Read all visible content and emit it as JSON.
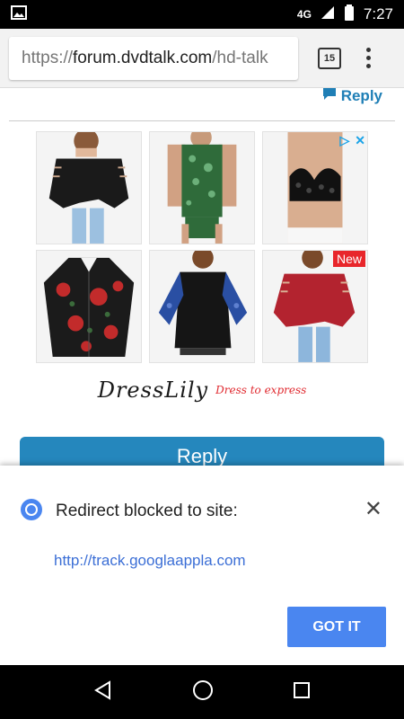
{
  "status_bar": {
    "network": "4G",
    "time": "7:27",
    "icons": [
      "image-notification-icon",
      "signal-icon",
      "battery-icon"
    ]
  },
  "browser": {
    "url_scheme": "https://",
    "url_domain": "forum.dvdtalk.com",
    "url_path": "/hd-talk",
    "tab_count": "15",
    "menu_icon": "overflow-menu-icon"
  },
  "page": {
    "reply_link": "Reply",
    "reply_button": "Reply"
  },
  "ad": {
    "choices_icons": [
      "ad-choices-icon",
      "ad-close-icon"
    ],
    "products": [
      {
        "name": "black-cutout-top"
      },
      {
        "name": "green-print-tank"
      },
      {
        "name": "black-lace-bralette"
      },
      {
        "name": "floral-shirt"
      },
      {
        "name": "black-blue-sleeve-top"
      },
      {
        "name": "red-cutout-top",
        "badge": "New"
      }
    ],
    "brand": "DressLily",
    "tagline": "Dress to express"
  },
  "redirect_dialog": {
    "title": "Redirect blocked to site:",
    "link": "http://track.googlaappla.com",
    "button": "GOT IT"
  },
  "colors": {
    "accent_blue": "#2587bd",
    "got_it_blue": "#4a86f0",
    "link_blue": "#3c6fd6",
    "badge_red": "#e8262b"
  }
}
